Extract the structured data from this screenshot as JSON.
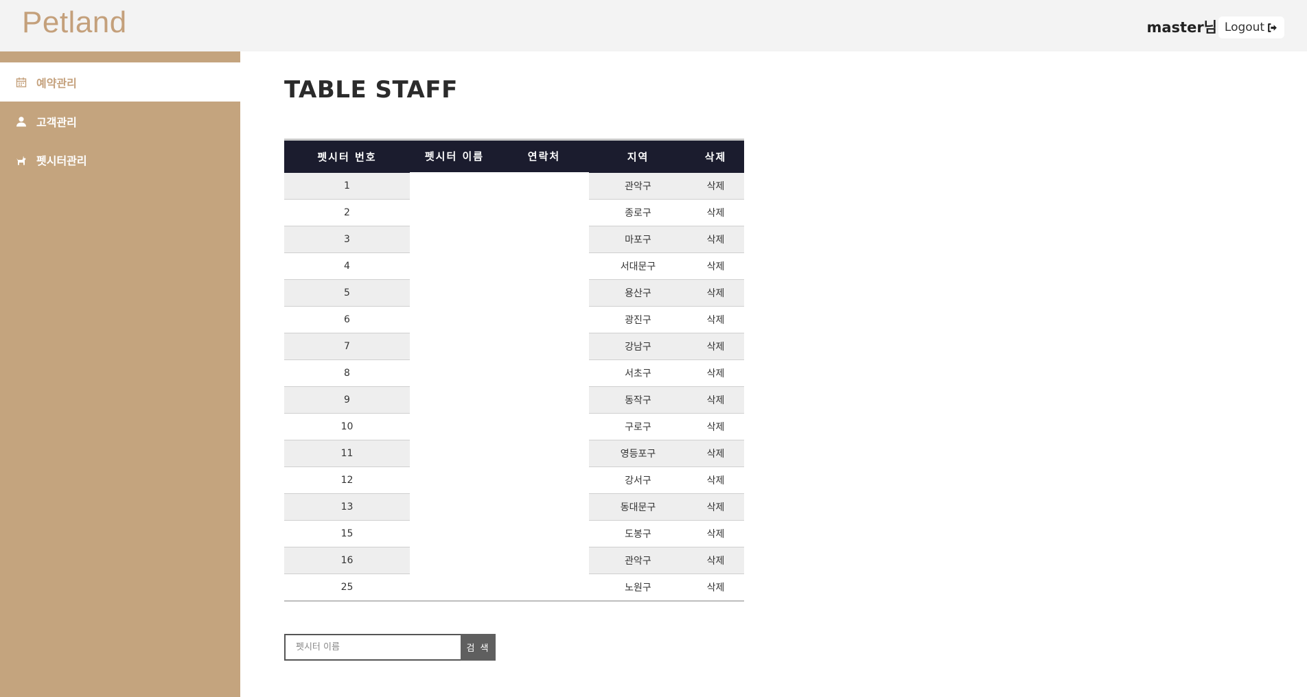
{
  "header": {
    "brand": "Petland",
    "user_label": "master님",
    "logout_label": "Logout"
  },
  "sidebar": {
    "items": [
      {
        "label": "예약관리",
        "icon": "calendar-icon",
        "active": true
      },
      {
        "label": "고객관리",
        "icon": "user-icon",
        "active": false
      },
      {
        "label": "펫시터관리",
        "icon": "dog-icon",
        "active": false
      }
    ]
  },
  "main": {
    "title": "TABLE STAFF",
    "table": {
      "columns": [
        "펫시터 번호",
        "펫시터 이름",
        "연락처",
        "지역",
        "삭제"
      ],
      "rows": [
        {
          "id": "1",
          "name": "",
          "phone": "",
          "region": "관악구",
          "action": "삭제"
        },
        {
          "id": "2",
          "name": "",
          "phone": "",
          "region": "종로구",
          "action": "삭제"
        },
        {
          "id": "3",
          "name": "",
          "phone": "",
          "region": "마포구",
          "action": "삭제"
        },
        {
          "id": "4",
          "name": "",
          "phone": "",
          "region": "서대문구",
          "action": "삭제"
        },
        {
          "id": "5",
          "name": "",
          "phone": "",
          "region": "용산구",
          "action": "삭제"
        },
        {
          "id": "6",
          "name": "",
          "phone": "",
          "region": "광진구",
          "action": "삭제"
        },
        {
          "id": "7",
          "name": "",
          "phone": "",
          "region": "강남구",
          "action": "삭제"
        },
        {
          "id": "8",
          "name": "",
          "phone": "",
          "region": "서초구",
          "action": "삭제"
        },
        {
          "id": "9",
          "name": "",
          "phone": "",
          "region": "동작구",
          "action": "삭제"
        },
        {
          "id": "10",
          "name": "",
          "phone": "",
          "region": "구로구",
          "action": "삭제"
        },
        {
          "id": "11",
          "name": "",
          "phone": "",
          "region": "영등포구",
          "action": "삭제"
        },
        {
          "id": "12",
          "name": "",
          "phone": "",
          "region": "강서구",
          "action": "삭제"
        },
        {
          "id": "13",
          "name": "",
          "phone": "",
          "region": "동대문구",
          "action": "삭제"
        },
        {
          "id": "15",
          "name": "",
          "phone": "",
          "region": "도봉구",
          "action": "삭제"
        },
        {
          "id": "16",
          "name": "",
          "phone": "",
          "region": "관악구",
          "action": "삭제"
        },
        {
          "id": "25",
          "name": "",
          "phone": "",
          "region": "노원구",
          "action": "삭제"
        }
      ]
    },
    "search": {
      "placeholder": "펫시터 이름",
      "value": "",
      "button_label": "검 색"
    }
  },
  "colors": {
    "brand": "#c4a07b",
    "sidebar_bg": "#c4a47e",
    "table_header_bg": "#1b1c2e",
    "search_button_bg": "#5f5f5f"
  }
}
